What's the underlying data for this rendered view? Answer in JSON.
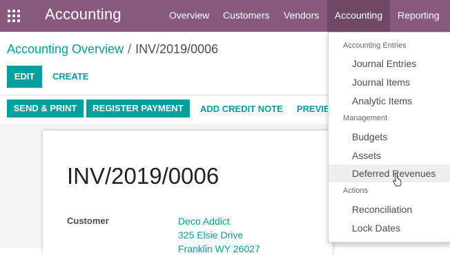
{
  "navbar": {
    "app_title": "Accounting",
    "menu": [
      "Overview",
      "Customers",
      "Vendors",
      "Accounting",
      "Reporting"
    ],
    "active_menu": "Accounting",
    "color": "#875a7b"
  },
  "breadcrumb": {
    "parent": "Accounting Overview",
    "separator": "/",
    "current": "INV/2019/0006"
  },
  "buttons": {
    "edit": "Edit",
    "create": "Create",
    "send_print": "Send & Print",
    "register_payment": "Register Payment",
    "add_credit_note": "Add Credit Note",
    "preview": "Previe"
  },
  "invoice": {
    "number": "INV/2019/0006",
    "customer_label": "Customer",
    "customer_name": "Deco Addict",
    "customer_street": "325 Elsie Drive",
    "customer_city": "Franklin WY 26027"
  },
  "dropdown": {
    "sections": [
      {
        "header": "Accounting Entries",
        "items": [
          "Journal Entries",
          "Journal Items",
          "Analytic Items"
        ]
      },
      {
        "header": "Management",
        "items": [
          "Budgets",
          "Assets",
          "Deferred Revenues"
        ]
      },
      {
        "header": "Actions",
        "items": [
          "Reconciliation",
          "Lock Dates"
        ]
      }
    ],
    "hovered_item": "Deferred Revenues"
  },
  "colors": {
    "accent": "#00a09d",
    "navbar": "#875a7b",
    "navbar_active": "#6e4965"
  },
  "icons": {
    "apps": "apps-grid-icon",
    "cursor": "hand-pointer-icon"
  }
}
